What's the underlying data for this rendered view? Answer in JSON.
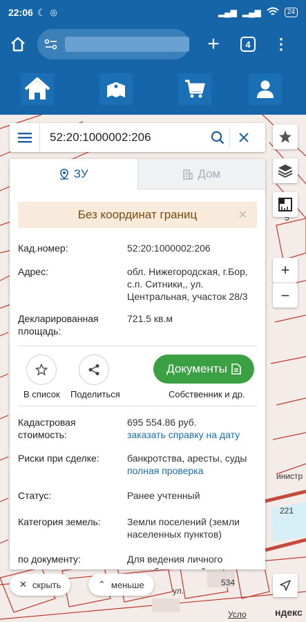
{
  "status_bar": {
    "time": "22:06",
    "battery": "24"
  },
  "browser": {
    "tab_count": "4",
    "plus": "+",
    "menu": "⋮"
  },
  "search": {
    "value": "52:20:1000002:206"
  },
  "map_controls": {
    "zoom_in": "+",
    "zoom_out": "−",
    "ruler_number": "5"
  },
  "map_labels": {
    "building_534": "534",
    "street": "ул.",
    "ministry": "инистр",
    "number_221": "221",
    "house_5": "5",
    "yandex": "ндекс",
    "terms": "Усло"
  },
  "panel": {
    "tabs": [
      {
        "label": "ЗУ",
        "icon": "map-pin-icon"
      },
      {
        "label": "Дом",
        "icon": "building-icon"
      }
    ],
    "notice": "Без координат границ",
    "cad_number_label": "Кад.номер:",
    "cad_number_value": "52:20:1000002:206",
    "address_label": "Адрес:",
    "address_value": "обл. Нижегородская, г.Бор, с.п. Ситники,, ул. Центральная, участок 28/3",
    "area_label": "Декларированная площадь:",
    "area_value": "721.5 кв.м",
    "actions": {
      "to_list": "В список",
      "share": "Поделиться",
      "documents": "Документы",
      "owners": "Собственник и др."
    },
    "cad_value_label": "Кадастровая стоимость:",
    "cad_value": "695 554.86 руб.",
    "cad_value_link": "заказать справку на дату",
    "risks_label": "Риски при сделке:",
    "risks_value": "банкротства, аресты, суды",
    "risks_link": "полная проверка",
    "status_label": "Статус:",
    "status_value": "Ранее учтенный",
    "land_cat_label": "Категория земель:",
    "land_cat_value": "Земли поселений (земли населенных пунктов)",
    "doc_label": "по документу:",
    "doc_value": "Для ведения личного подсобного хозяйства"
  },
  "bottom": {
    "hide": "скрыть",
    "less": "меньше"
  },
  "colors": {
    "brand_blue": "#1565a8",
    "green_button": "#3aa043",
    "notice_bg": "#f8ebdb",
    "parcel_red": "#c0392b"
  }
}
